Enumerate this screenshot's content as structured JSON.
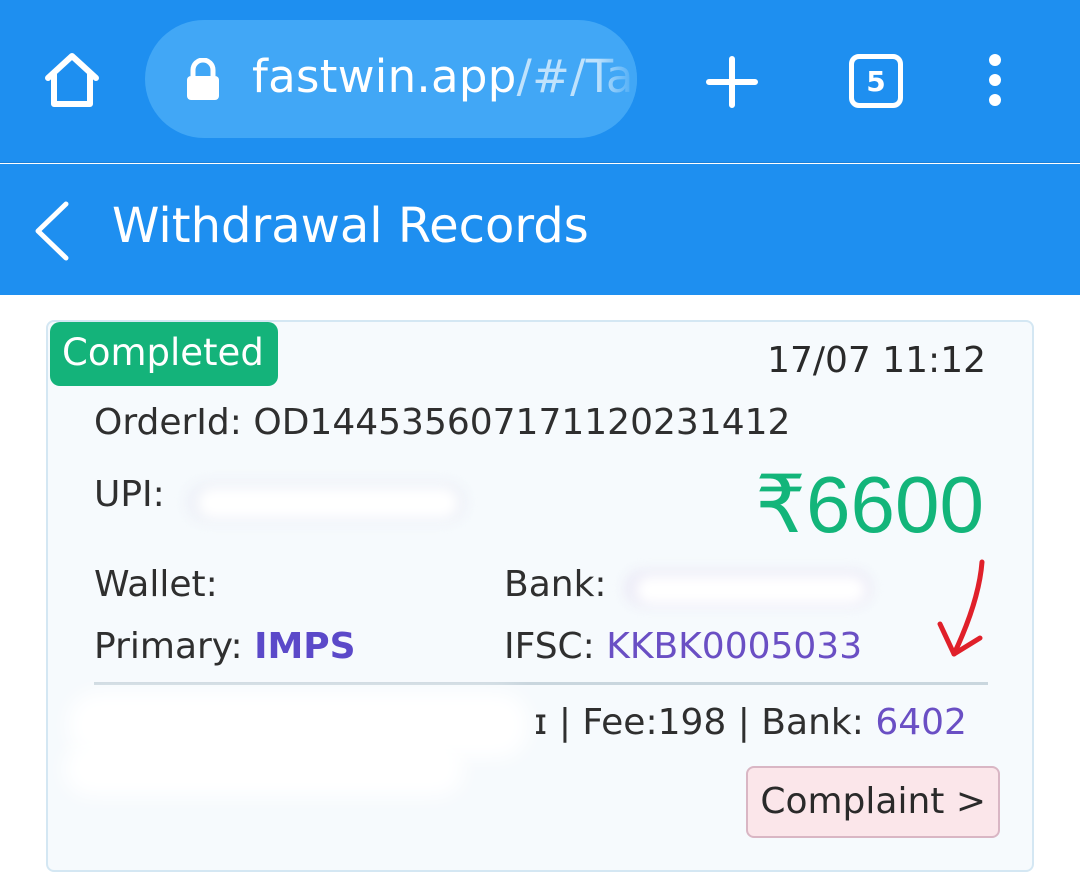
{
  "browser": {
    "url_host": "fastwin.app",
    "url_path": "/#/Ta",
    "tab_count": "5"
  },
  "header": {
    "title": "Withdrawal Records"
  },
  "record": {
    "status": "Completed",
    "datetime": "17/07 11:12",
    "order_label": "OrderId:",
    "order_id": "OD1445356071711202314​12",
    "upi_label": "UPI:",
    "amount": "₹6600",
    "wallet_label": "Wallet:",
    "primary_label": "Primary:",
    "primary_value": "IMPS",
    "bank_label": "Bank:",
    "ifsc_label": "IFSC:",
    "ifsc_value": "KKBK0005033",
    "footer_partial": "| Fee:198 | Bank:",
    "footer_bank_value": "6402",
    "complaint_label": "Complaint >"
  },
  "colors": {
    "brand_blue": "#1e8ff0",
    "status_green": "#14b37a",
    "amount_green": "#13b57a",
    "value_purple": "#6a4fc4",
    "annotation_red": "#e0202a"
  },
  "icons": {
    "home": "home-icon",
    "lock": "lock-icon",
    "new_tab": "plus-icon",
    "tabs": "tab-count-icon",
    "menu": "kebab-menu-icon",
    "back": "chevron-left-icon",
    "annotation": "red-arrow-icon"
  }
}
